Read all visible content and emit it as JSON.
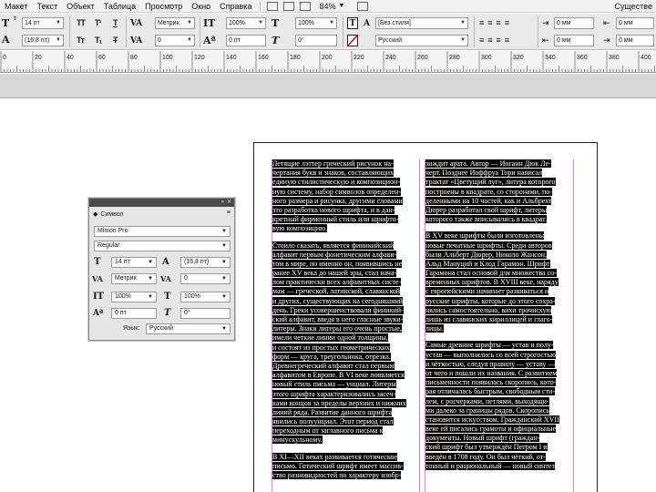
{
  "menubar": {
    "items": [
      "Макет",
      "Текст",
      "Объект",
      "Таблица",
      "Просмотр",
      "Окно",
      "Справка"
    ],
    "zoom": "84%",
    "workspace": "Существе"
  },
  "control": {
    "font_size": "14 пт",
    "leading": "(16,8 пт)",
    "kerning": "Метрик",
    "tracking": "0",
    "vscale": "100%",
    "hscale": "100%",
    "baseline": "0 пт",
    "skew": "0°",
    "char_style": "[Без стиля]",
    "language": "Русский",
    "indent_top": "0 мм",
    "indent_bottom": "0 мм",
    "cap_T": "TT",
    "sup": "T¹",
    "under": "T",
    "small_caps": "Tт",
    "sub": "T₁",
    "strike": "T"
  },
  "ruler": {
    "labels": [
      "0",
      "20",
      "40",
      "60",
      "80",
      "100",
      "120",
      "140",
      "160",
      "180",
      "200",
      "220",
      "240",
      "260",
      "280",
      "300",
      "320",
      "340",
      "360",
      "380",
      "400"
    ]
  },
  "page": {
    "left_column": [
      [
        "Летящие лэттер греческий рисунок на-",
        "чертания букв и знаков, составляющих",
        "единую стилистическую и композицион-",
        "ную систему, набор символов определен-",
        "ного размера и рисунка, другими словами",
        "это разработка нового шрифта, и в дан-",
        "кретный фирменный стиль или шрифто-",
        "вую композицию."
      ],
      [
        "Стоило сказать, является финикийский",
        "алфавит первым фонетическим алфави-",
        "том в мире, по именно он, появившись не",
        "ранее XV века до нашей эры, стал нача-",
        "лом практически всех алфавитных систе-",
        "мам — греческой, латинской, славянской",
        "и других, существующих на сегодняшний",
        "день. Греки усовершенствовали финикий-",
        "ский алфавит, введя в него гласные звуки-",
        "литеры. Знаки литеры его очень простые,",
        "имели четкие линии одной толщины,",
        "и состоят из простых геометрических",
        "форм — круга, треугольника, отрезка.",
        "Древнегреческий алфавит стал первым",
        "алфавитом в Европе. В VI веке появляется",
        "новый стиль письма — унциал. Литеры",
        "этого шрифта характеризовались засеч-",
        "ками концов за пределы верхних и нижних",
        "линий ряда. Развитие данного шрифта",
        "явились полуунциал. Этот период стал",
        "переходным от заглавного письма к",
        "минускульному."
      ],
      [
        "В XI—XII веках развивается готическое",
        "письмо. Готический шрифт имеет массив-",
        "ство разновидностей по характеру изобр-"
      ]
    ],
    "right_column": [
      [
        "зиждит арата. Автор — Иоганн Дюк Ле-",
        "черт. Позднее Иоффруа Тори написал",
        "трактат «Цветущий луг», литера которого",
        "построены в квадрате, со сторонами, по-",
        "деленными на 10 частей, как и Альбрехт",
        "Дюрер разработал свой шрифт, литеры",
        "которого также вписывались в квадрат."
      ],
      [
        "В XV веке шрифты были изготовлены",
        "новые печатные шрифты. Среди авторов",
        "были Альберт Дюрер, Николо Жансон,",
        "Альд Мануций и Клод Гарамон. Шрифт",
        "Гарамона стал основой для множества со-",
        "временных шрифтов. В XVIII веке, наряду",
        "с европейскими начинает развиваться и",
        "русские шрифты, которые до этого сохра-",
        "нялись самостоятельно, вихи трочисхую",
        "лишь из славянских кириллицей и глаго-",
        "лицы."
      ],
      [
        "Самые древние шрифты — устав и полу-",
        "устав — выполнялись со всей строгостью",
        "и чёткостью, следуя правилу — уставу —",
        "от чего и пошли их названия. С развитием",
        "письменности появилась скоропись, кото-",
        "рая отличалась быстрым, свободным сти-",
        "лем, с росчерками, петлями, выходящи-",
        "ми далеко за границы рядов. Скоропись",
        "становится искусством. Гражданский XVII",
        "веке ей писались грамоты и официальные",
        "документы. Новый шрифт (граждан-",
        "ский шрифт был утверждён Петром I и",
        "введён в 1708 году. Он был чёткий, от-",
        "тонный и рациональный — новый синтез"
      ]
    ]
  },
  "charpanel": {
    "title": "Символ",
    "font_family": "Minion Pro",
    "font_style": "Regular",
    "size": "14 пт",
    "leading": "(16,8 пт)",
    "kerning": "Метрик",
    "tracking": "0",
    "vscale": "100%",
    "hscale": "100%",
    "baseline": "0 пт",
    "skew": "0°",
    "lang_label": "Язык:",
    "language": "Русский"
  }
}
